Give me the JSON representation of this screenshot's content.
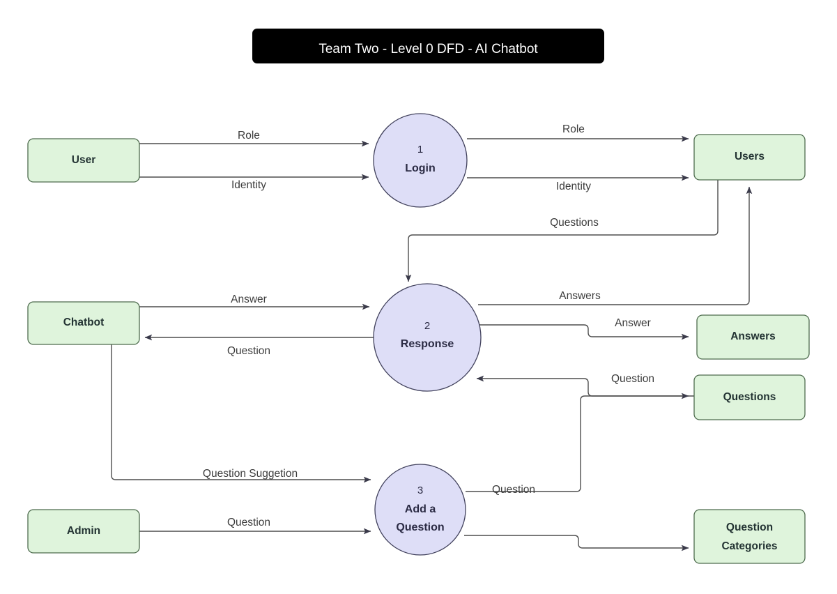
{
  "title_banner": {
    "text": "Team Two - Level 0 DFD - AI Chatbot",
    "background": "#000000",
    "text_color": "#ffffff"
  },
  "palette": {
    "entity_fill": "#dff4dc",
    "entity_stroke": "#4d6b4d",
    "process_fill": "#dedef7",
    "process_stroke": "#41415c",
    "flow_stroke": "#4d4d4d",
    "label_color": "#3c3c3c"
  },
  "external_entities": [
    {
      "id": "user",
      "label": "User"
    },
    {
      "id": "chatbot",
      "label": "Chatbot"
    },
    {
      "id": "admin",
      "label": "Admin"
    }
  ],
  "processes": [
    {
      "id": "p1",
      "number": "1",
      "name": "Login"
    },
    {
      "id": "p2",
      "number": "2",
      "name": "Response"
    },
    {
      "id": "p3",
      "number": "3",
      "name_line1": "Add a",
      "name_line2": "Question"
    }
  ],
  "data_stores": [
    {
      "id": "users",
      "label": "Users"
    },
    {
      "id": "answers",
      "label": "Answers"
    },
    {
      "id": "questions",
      "label": "Questions"
    },
    {
      "id": "question_categories",
      "label_line1": "Question",
      "label_line2": "Categories"
    }
  ],
  "flows": [
    {
      "id": "f1",
      "label": "Role",
      "from": "User",
      "to": "1 Login"
    },
    {
      "id": "f2",
      "label": "Identity",
      "from": "User",
      "to": "1 Login"
    },
    {
      "id": "f3",
      "label": "Role",
      "from": "1 Login",
      "to": "Users"
    },
    {
      "id": "f4",
      "label": "Identity",
      "from": "1 Login",
      "to": "Users"
    },
    {
      "id": "f5",
      "label": "Questions",
      "from": "Users",
      "to": "2 Response"
    },
    {
      "id": "f6",
      "label": "Answers",
      "from": "2 Response",
      "to": "Users"
    },
    {
      "id": "f7",
      "label": "Answer",
      "from": "Chatbot",
      "to": "2 Response"
    },
    {
      "id": "f8",
      "label": "Question",
      "from": "2 Response",
      "to": "Chatbot"
    },
    {
      "id": "f9",
      "label": "Answer",
      "from": "2 Response",
      "to": "Answers"
    },
    {
      "id": "f10",
      "label": "Question",
      "from": "Questions",
      "to": "2 Response"
    },
    {
      "id": "f11",
      "label": "Question Suggetion",
      "from": "Chatbot",
      "to": "3 Add a Question"
    },
    {
      "id": "f12",
      "label": "Question",
      "from": "Admin",
      "to": "3 Add a Question"
    },
    {
      "id": "f13",
      "label": "Question",
      "from": "3 Add a Question",
      "to": "Questions"
    },
    {
      "id": "f14",
      "label": "",
      "from": "3 Add a Question",
      "to": "Question Categories"
    }
  ]
}
